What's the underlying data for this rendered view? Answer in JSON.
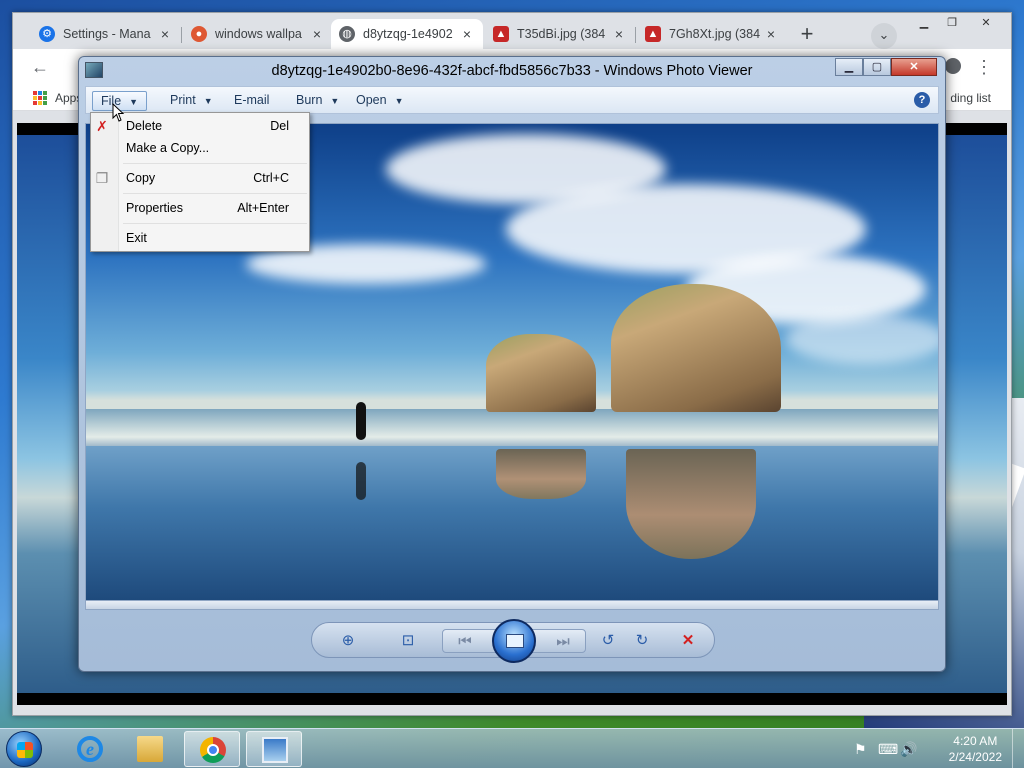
{
  "browser": {
    "tabs": [
      {
        "label": "Settings - Mana",
        "favicon": "gear-icon",
        "active": false
      },
      {
        "label": "windows wallpa",
        "favicon": "duckduckgo-icon",
        "active": false
      },
      {
        "label": "d8ytzqg-1e4902",
        "favicon": "globe-icon",
        "active": true
      },
      {
        "label": "T35dBi.jpg (384",
        "favicon": "image-icon",
        "active": false
      },
      {
        "label": "7Gh8Xt.jpg (384",
        "favicon": "image-icon",
        "active": false
      }
    ],
    "new_tab": "+",
    "tab_search": "⌄",
    "bookmarks": {
      "apps_label": "Apps",
      "reading_list": "ding list"
    }
  },
  "photo_viewer": {
    "title": "d8ytzqg-1e4902b0-8e96-432f-abcf-fbd5856c7b33 - Windows Photo Viewer",
    "menu": {
      "file": "File",
      "print": "Print",
      "email": "E-mail",
      "burn": "Burn",
      "open": "Open"
    },
    "help": "?",
    "file_menu": [
      {
        "label": "Delete",
        "shortcut": "Del",
        "icon": "delete-x-icon"
      },
      {
        "label": "Make a Copy...",
        "shortcut": ""
      },
      {
        "label": "Copy",
        "shortcut": "Ctrl+C",
        "icon": "copy-icon"
      },
      {
        "label": "Properties",
        "shortcut": "Alt+Enter"
      },
      {
        "label": "Exit",
        "shortcut": ""
      }
    ]
  },
  "taskbar": {
    "time": "4:20 AM",
    "date": "2/24/2022"
  },
  "colors": {
    "accent": "#2a5ca8",
    "delete_red": "#d32020"
  }
}
